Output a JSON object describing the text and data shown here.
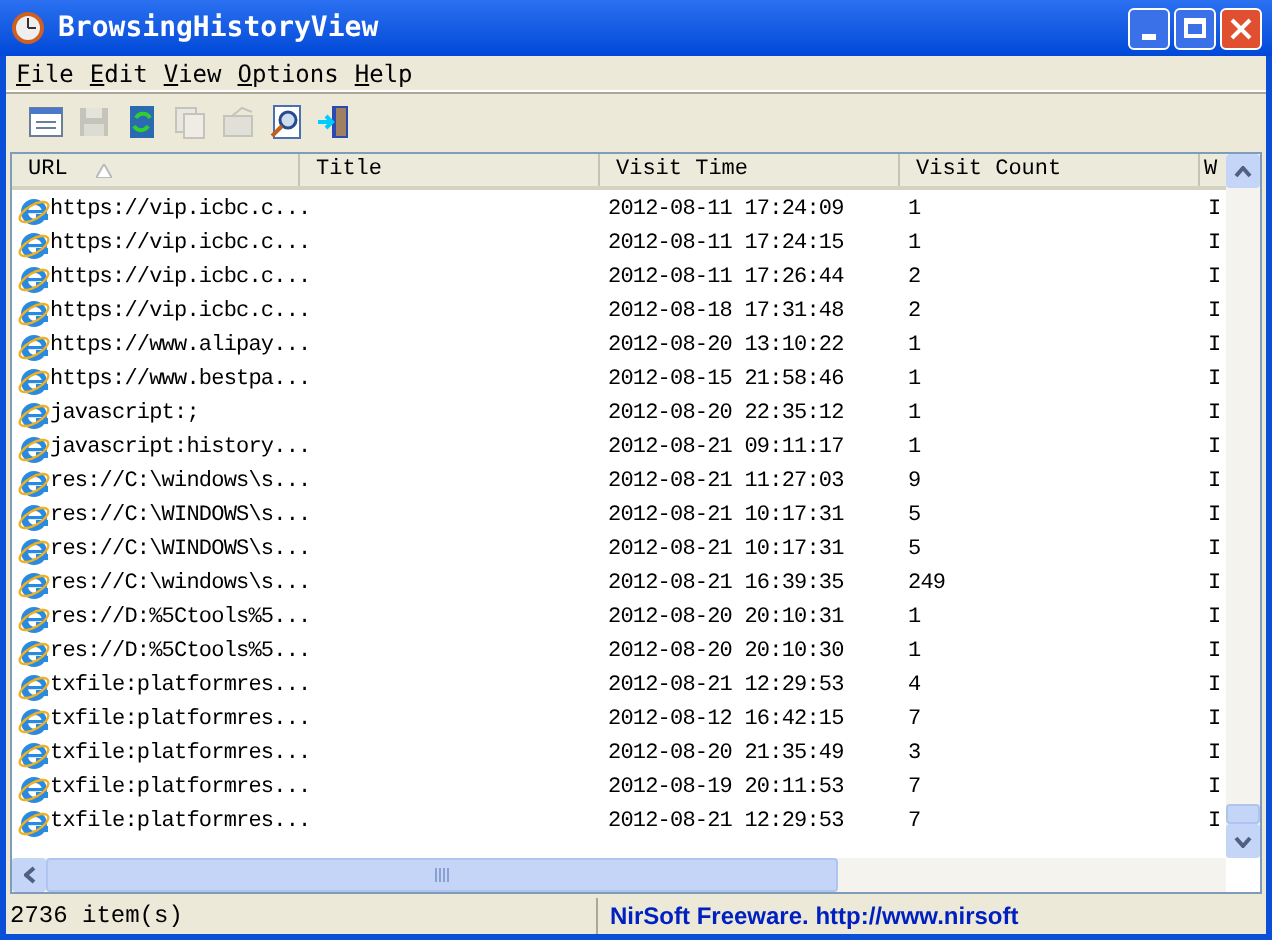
{
  "window": {
    "title": "BrowsingHistoryView"
  },
  "menu": [
    {
      "label": "File"
    },
    {
      "label": "Edit"
    },
    {
      "label": "View"
    },
    {
      "label": "Options"
    },
    {
      "label": "Help"
    }
  ],
  "toolbar": [
    {
      "kind": "report",
      "disabled": false
    },
    {
      "kind": "save",
      "disabled": true
    },
    {
      "kind": "refresh",
      "disabled": false
    },
    {
      "kind": "copy",
      "disabled": true
    },
    {
      "kind": "properties",
      "disabled": true
    },
    {
      "kind": "find",
      "disabled": false
    },
    {
      "kind": "exit",
      "disabled": false
    }
  ],
  "table": {
    "columns": [
      {
        "label": "URL",
        "sorted": true
      },
      {
        "label": "Title",
        "sorted": false
      },
      {
        "label": "Visit Time",
        "sorted": false
      },
      {
        "label": "Visit Count",
        "sorted": false
      },
      {
        "label": "W",
        "sorted": false
      }
    ],
    "rows": [
      [
        "https://vip.icbc.c...",
        "",
        "2012-08-11 17:24:09",
        "1",
        "I"
      ],
      [
        "https://vip.icbc.c...",
        "",
        "2012-08-11 17:24:15",
        "1",
        "I"
      ],
      [
        "https://vip.icbc.c...",
        "",
        "2012-08-11 17:26:44",
        "2",
        "I"
      ],
      [
        "https://vip.icbc.c...",
        "",
        "2012-08-18 17:31:48",
        "2",
        "I"
      ],
      [
        "https://www.alipay...",
        "",
        "2012-08-20 13:10:22",
        "1",
        "I"
      ],
      [
        "https://www.bestpa...",
        "",
        "2012-08-15 21:58:46",
        "1",
        "I"
      ],
      [
        "javascript:;",
        "",
        "2012-08-20 22:35:12",
        "1",
        "I"
      ],
      [
        "javascript:history...",
        "",
        "2012-08-21 09:11:17",
        "1",
        "I"
      ],
      [
        "res://C:\\windows\\s...",
        "",
        "2012-08-21 11:27:03",
        "9",
        "I"
      ],
      [
        "res://C:\\WINDOWS\\s...",
        "",
        "2012-08-21 10:17:31",
        "5",
        "I"
      ],
      [
        "res://C:\\WINDOWS\\s...",
        "",
        "2012-08-21 10:17:31",
        "5",
        "I"
      ],
      [
        "res://C:\\windows\\s...",
        "",
        "2012-08-21 16:39:35",
        "249",
        "I"
      ],
      [
        "res://D:%5Ctools%5...",
        "",
        "2012-08-20 20:10:31",
        "1",
        "I"
      ],
      [
        "res://D:%5Ctools%5...",
        "",
        "2012-08-20 20:10:30",
        "1",
        "I"
      ],
      [
        "txfile:platformres...",
        "",
        "2012-08-21 12:29:53",
        "4",
        "I"
      ],
      [
        "txfile:platformres...",
        "",
        "2012-08-12 16:42:15",
        "7",
        "I"
      ],
      [
        "txfile:platformres...",
        "",
        "2012-08-20 21:35:49",
        "3",
        "I"
      ],
      [
        "txfile:platformres...",
        "",
        "2012-08-19 20:11:53",
        "7",
        "I"
      ],
      [
        "txfile:platformres...",
        "",
        "2012-08-21 12:29:53",
        "7",
        "I"
      ]
    ]
  },
  "status_bar": {
    "count": "2736 item(s)",
    "credit": "NirSoft Freeware.  http://www.nirsoft"
  }
}
